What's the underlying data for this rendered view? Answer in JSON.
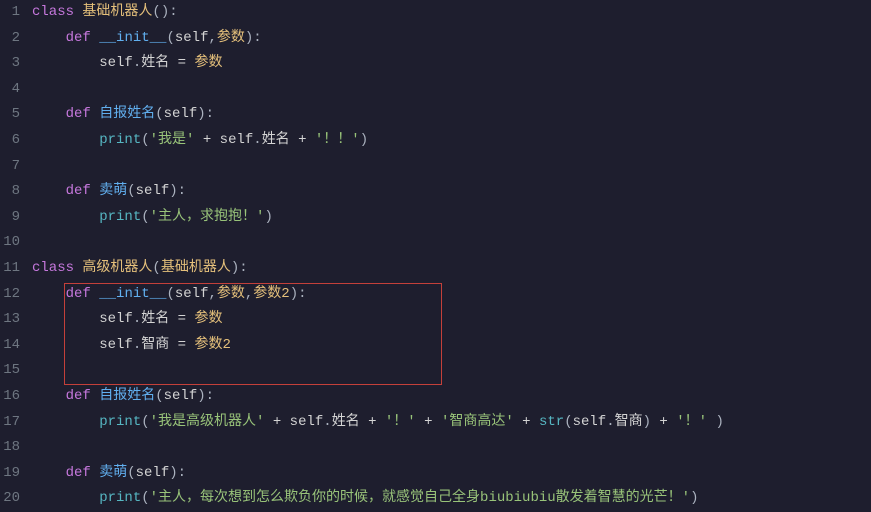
{
  "lineNumbers": [
    "1",
    "2",
    "3",
    "4",
    "5",
    "6",
    "7",
    "8",
    "9",
    "10",
    "11",
    "12",
    "13",
    "14",
    "15",
    "16",
    "17",
    "18",
    "19",
    "20"
  ],
  "code": {
    "l1": {
      "kw": "class",
      "sp": " ",
      "name": "基础机器人",
      "p": "():"
    },
    "l2": {
      "ind": "    ",
      "kw": "def",
      "sp": " ",
      "fn": "__init__",
      "pl": "(",
      "self": "self",
      "c": ",",
      "p1": "参数",
      "pr": "):"
    },
    "l3": {
      "ind": "        ",
      "self": "self",
      "dot": ".",
      "attr": "姓名",
      "sp": " ",
      "eq": "=",
      "sp2": " ",
      "p1": "参数"
    },
    "l5": {
      "ind": "    ",
      "kw": "def",
      "sp": " ",
      "fn": "自报姓名",
      "pl": "(",
      "self": "self",
      "pr": "):"
    },
    "l6": {
      "ind": "        ",
      "fn": "print",
      "pl": "(",
      "s1": "'我是'",
      "plus": " + ",
      "self": "self",
      "dot": ".",
      "attr": "姓名",
      "plus2": " + ",
      "s2": "'！！'",
      "pr": ")"
    },
    "l8": {
      "ind": "    ",
      "kw": "def",
      "sp": " ",
      "fn": "卖萌",
      "pl": "(",
      "self": "self",
      "pr": "):"
    },
    "l9": {
      "ind": "        ",
      "fn": "print",
      "pl": "(",
      "s1": "'主人，求抱抱！'",
      "pr": ")"
    },
    "l11": {
      "kw": "class",
      "sp": " ",
      "name": "高级机器人",
      "pl": "(",
      "base": "基础机器人",
      "pr": "):"
    },
    "l12": {
      "ind": "    ",
      "kw": "def",
      "sp": " ",
      "fn": "__init__",
      "pl": "(",
      "self": "self",
      "c": ",",
      "p1": "参数",
      "c2": ",",
      "p2": "参数2",
      "pr": "):"
    },
    "l13": {
      "ind": "        ",
      "self": "self",
      "dot": ".",
      "attr": "姓名",
      "sp": " ",
      "eq": "=",
      "sp2": " ",
      "p1": "参数"
    },
    "l14": {
      "ind": "        ",
      "self": "self",
      "dot": ".",
      "attr": "智商",
      "sp": " ",
      "eq": "=",
      "sp2": " ",
      "p1": "参数2"
    },
    "l16": {
      "ind": "    ",
      "kw": "def",
      "sp": " ",
      "fn": "自报姓名",
      "pl": "(",
      "self": "self",
      "pr": "):"
    },
    "l17": {
      "ind": "        ",
      "fn": "print",
      "pl": "(",
      "s1": "'我是高级机器人'",
      "plus": " + ",
      "self": "self",
      "dot": ".",
      "attr": "姓名",
      "plus2": " + ",
      "s2": "'！'",
      "plus3": " + ",
      "s3": "'智商高达'",
      "plus4": " + ",
      "str": "str",
      "pl2": "(",
      "self2": "self",
      "dot2": ".",
      "attr2": "智商",
      "pr2": ")",
      "plus5": " + ",
      "s4": "'！'",
      "sp": " ",
      "pr": ")"
    },
    "l19": {
      "ind": "    ",
      "kw": "def",
      "sp": " ",
      "fn": "卖萌",
      "pl": "(",
      "self": "self",
      "pr": "):"
    },
    "l20": {
      "ind": "        ",
      "fn": "print",
      "pl": "(",
      "s1": "'主人，每次想到怎么欺负你的时候，就感觉自己全身biubiubiu散发着智慧的光芒！'",
      "pr": ")"
    }
  }
}
